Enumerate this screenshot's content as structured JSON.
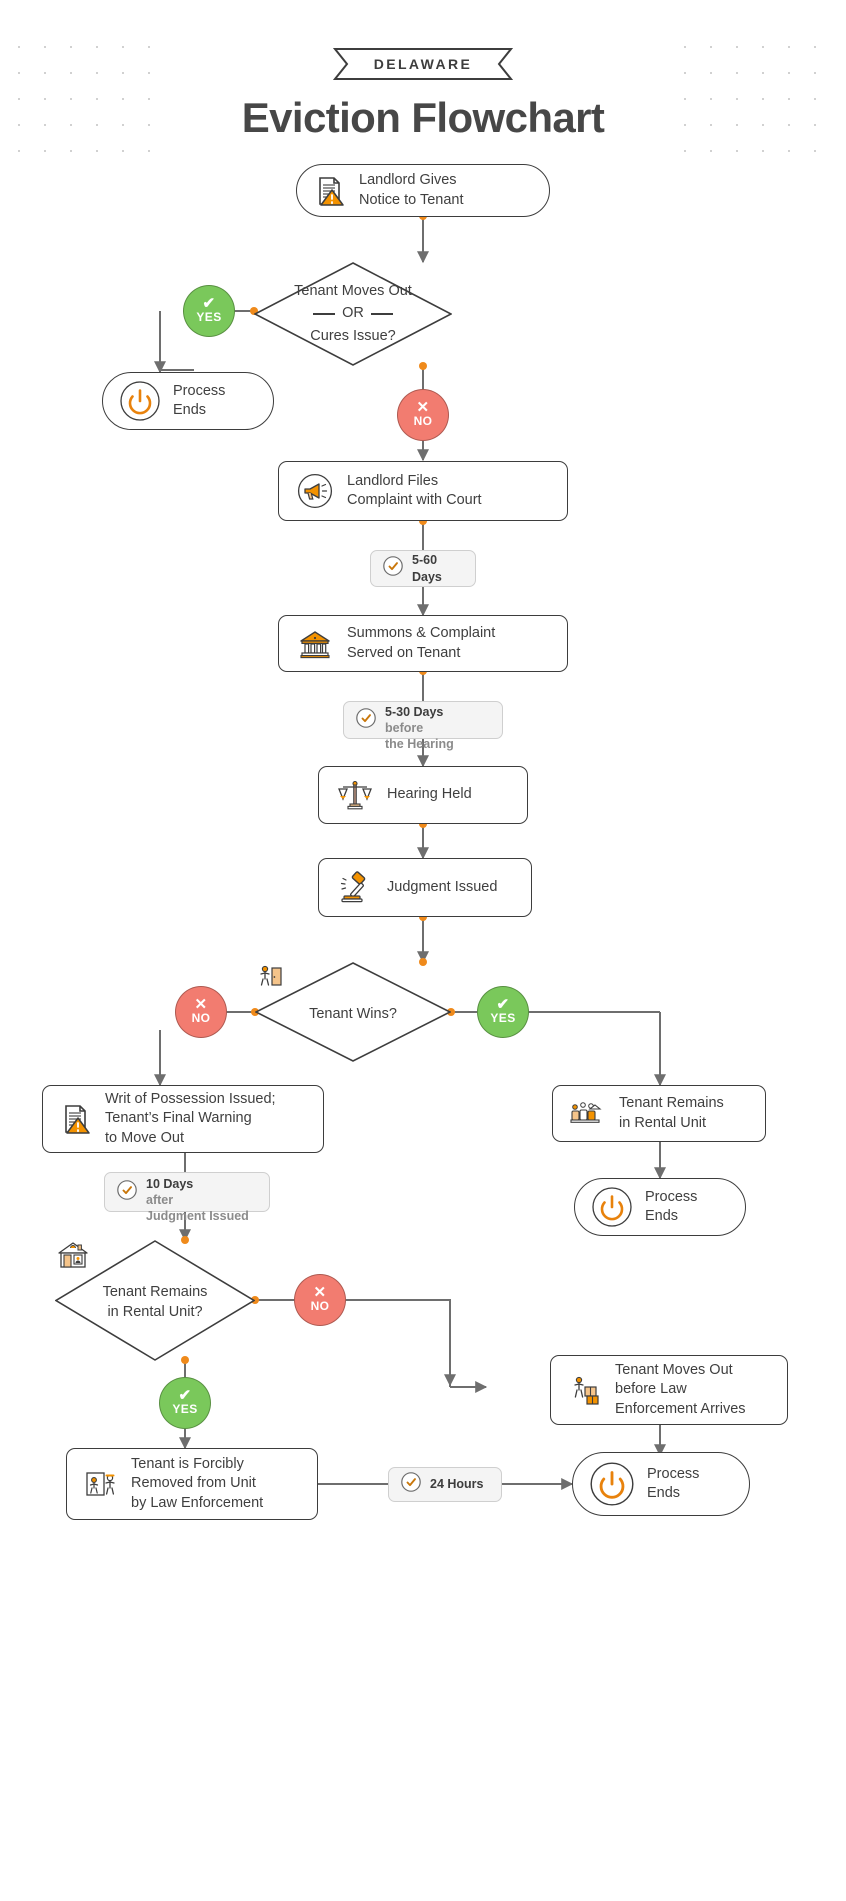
{
  "header": {
    "ribbon_label": "DELAWARE",
    "title": "Eviction Flowchart"
  },
  "colors": {
    "accent_orange": "#E8820C",
    "yes_green": "#7AC85B",
    "no_red": "#F27C70",
    "ink": "#3D3D3D",
    "wire": "#6E6E6E",
    "node_fill": "#FFFFFF",
    "time_fill": "#F4F4F4"
  },
  "badges": {
    "yes": {
      "mark": "✔",
      "label": "YES"
    },
    "no": {
      "mark": "✕",
      "label": "NO"
    }
  },
  "nodes": {
    "landlord_notice": {
      "label": "Landlord Gives\nNotice to Tenant",
      "icon": "document-warning-icon"
    },
    "decision_moves_out": {
      "line1": "Tenant Moves Out",
      "line2": "OR",
      "line3": "Cures Issue?"
    },
    "process_ends_1": {
      "label": "Process\nEnds",
      "icon": "power-icon"
    },
    "landlord_files": {
      "label": "Landlord Files\nComplaint with Court",
      "icon": "megaphone-icon"
    },
    "summons_served": {
      "label": "Summons & Complaint\nServed on Tenant",
      "icon": "courthouse-icon"
    },
    "hearing_held": {
      "label": "Hearing Held",
      "icon": "scales-icon"
    },
    "judgment_issued": {
      "label": "Judgment Issued",
      "icon": "gavel-icon"
    },
    "decision_tenant_wins": {
      "label": "Tenant Wins?",
      "icon": "tenant-wins-icon"
    },
    "writ_possession": {
      "label": "Writ of Possession Issued;\nTenant’s Final Warning\nto Move Out",
      "icon": "document-warning-icon"
    },
    "tenant_remains": {
      "label": "Tenant Remains\nin Rental Unit",
      "icon": "family-home-icon"
    },
    "process_ends_2": {
      "label": "Process\nEnds",
      "icon": "power-icon"
    },
    "decision_remains": {
      "label": "Tenant Remains\nin Rental Unit?",
      "icon": "house-window-icon"
    },
    "tenant_moves_before": {
      "label": "Tenant Moves Out\nbefore Law\nEnforcement Arrives",
      "icon": "moving-boxes-icon"
    },
    "forcibly_removed": {
      "label": "Tenant is Forcibly\nRemoved from Unit\nby Law Enforcement",
      "icon": "officer-removal-icon"
    },
    "process_ends_3": {
      "label": "Process\nEnds",
      "icon": "power-icon"
    }
  },
  "timeboxes": {
    "t_5_60": {
      "strong": "5-60",
      "strong2": "Days",
      "soft": "",
      "icon": "clock-icon",
      "display": "5-60\nDays"
    },
    "t_5_30": {
      "strong": "5-30 Days",
      "soft": "before\nthe Hearing",
      "icon": "clock-icon"
    },
    "t_10_days": {
      "strong": "10 Days",
      "soft": "after\nJudgment Issued",
      "icon": "clock-icon"
    },
    "t_24_hours": {
      "strong": "24 Hours",
      "soft": "",
      "icon": "clock-icon"
    }
  }
}
